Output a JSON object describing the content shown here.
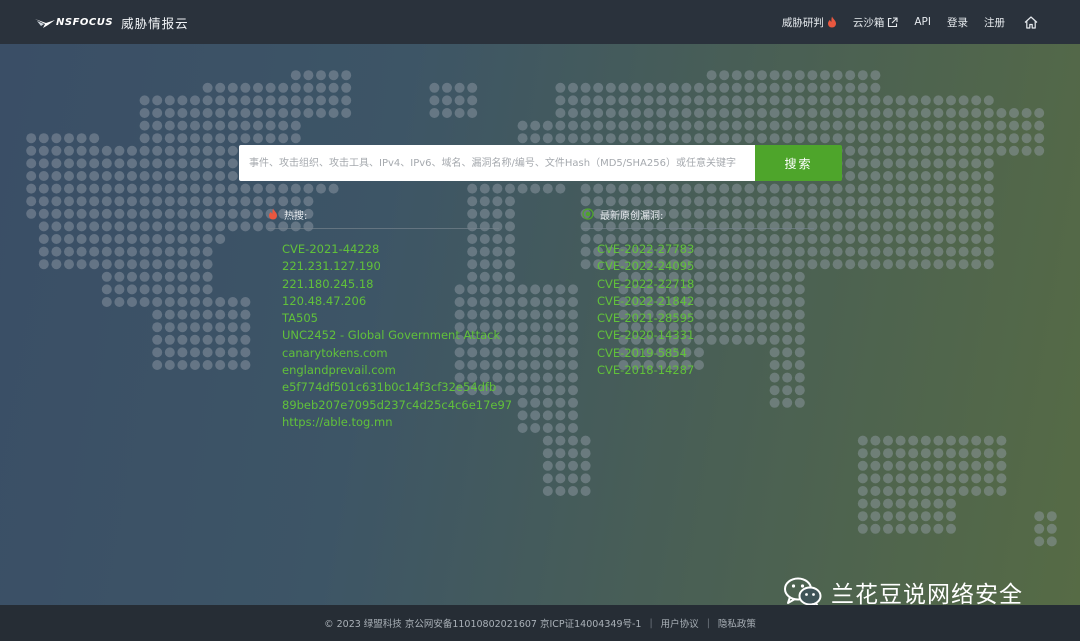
{
  "header": {
    "brand": "NSFOCUS",
    "brand_sub": "威胁情报云",
    "nav": {
      "threat_research": "威胁研判",
      "sandbox": "云沙箱",
      "api": "API",
      "login": "登录",
      "register": "注册"
    }
  },
  "search": {
    "placeholder": "事件、攻击组织、攻击工具、IPv4、IPv6、域名、漏洞名称/编号、文件Hash（MD5/SHA256）或任意关键字",
    "button": "搜索"
  },
  "hot_search": {
    "title": "热搜:",
    "items": [
      "CVE-2021-44228",
      "221.231.127.190",
      "221.180.245.18",
      "120.48.47.206",
      "TA505",
      "UNC2452 - Global Government Attack",
      "canarytokens.com",
      "englandprevail.com",
      "e5f774df501c631b0c14f3cf32e54dfb",
      "89beb207e7095d237c4d25c4c6e17e97",
      "https://able.tog.mn"
    ]
  },
  "latest_vulns": {
    "title": "最新原创漏洞:",
    "items": [
      "CVE-2022-27783",
      "CVE-2022-24095",
      "CVE-2022-22718",
      "CVE-2022-21842",
      "CVE-2021-28595",
      "CVE-2020-14331",
      "CVE-2019-5854",
      "CVE-2018-14287"
    ]
  },
  "watermark": "兰花豆说网络安全",
  "footer": {
    "copyright": "© 2023 绿盟科技 京公网安备11010802021607 京ICP证14004349号-1",
    "user_agreement": "用户协议",
    "privacy": "隐私政策"
  },
  "colors": {
    "accent_green": "#4ea52b",
    "link_green": "#61c13a",
    "header_bg": "#2a323c",
    "fire_icon": "#e9573f"
  }
}
